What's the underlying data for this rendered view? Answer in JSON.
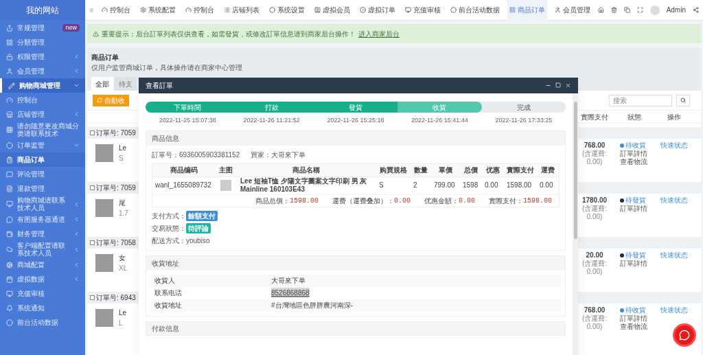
{
  "sidebar": {
    "title": "我的网站",
    "items": [
      {
        "label": "常规管理",
        "kind": "link",
        "selected": false,
        "badge": "new"
      },
      {
        "label": "分類管理",
        "kind": "link",
        "selected": false
      },
      {
        "label": "权限管理",
        "kind": "group",
        "selected": false,
        "expanded": false
      },
      {
        "label": "会员管理",
        "kind": "group",
        "selected": false,
        "expanded": false
      },
      {
        "label": "购物商城管理",
        "kind": "group",
        "selected": true,
        "expanded": true,
        "children": [
          {
            "label": "控制台",
            "kind": "link",
            "selected": false
          },
          {
            "label": "店铺管理",
            "kind": "group",
            "selected": false,
            "expanded": false
          },
          {
            "label": "请勿随意更改商城分类请联系技术",
            "kind": "link",
            "selected": false
          },
          {
            "label": "订单监管",
            "kind": "group",
            "selected": false,
            "expanded": true,
            "children": [
              {
                "label": "商品订单",
                "kind": "link",
                "selected": true
              },
              {
                "label": "评论管理",
                "kind": "link",
                "selected": false
              },
              {
                "label": "退款管理",
                "kind": "link",
                "selected": false
              }
            ]
          }
        ]
      },
      {
        "label": "购物商城请联系技术人员",
        "kind": "group",
        "selected": false,
        "expanded": false
      },
      {
        "label": "有图服务器通道",
        "kind": "group",
        "selected": false,
        "expanded": false
      },
      {
        "label": "财务管理",
        "kind": "group",
        "selected": false,
        "expanded": false
      },
      {
        "label": "客户端配置请联系技术人员",
        "kind": "group",
        "selected": false,
        "expanded": false
      },
      {
        "label": "商城配置",
        "kind": "group",
        "selected": false,
        "expanded": false
      },
      {
        "label": "虚拟数据",
        "kind": "group",
        "selected": false,
        "expanded": false
      },
      {
        "label": "充值审核",
        "kind": "link",
        "selected": false
      },
      {
        "label": "系统通知",
        "kind": "link",
        "selected": false
      },
      {
        "label": "前台活动数据",
        "kind": "link",
        "selected": false
      }
    ]
  },
  "top_tabs": [
    {
      "label": "控制台",
      "selected": false
    },
    {
      "label": "系统配置",
      "selected": false
    },
    {
      "label": "控制台",
      "selected": false
    },
    {
      "label": "店铺列表",
      "selected": false
    },
    {
      "label": "系统设置",
      "selected": false
    },
    {
      "label": "虚拟会员",
      "selected": false
    },
    {
      "label": "虚拟订单",
      "selected": false
    },
    {
      "label": "充值审核",
      "selected": false
    },
    {
      "label": "前台活动数据",
      "selected": false
    },
    {
      "label": "商品订单",
      "selected": true
    },
    {
      "label": "会员管理",
      "selected": false
    }
  ],
  "user": {
    "name": "Admin"
  },
  "alert": {
    "text": "重要提示：后台訂單列表仅供查看，如需發貨，或修改訂單信息请到商家后台操作！",
    "link": "进入商家后台"
  },
  "panel": {
    "title": "商品订单",
    "subtitle": "仅用户监管商城订单，具体操作请在商家中心管理",
    "tabs": [
      {
        "label": "全部",
        "selected": true
      },
      {
        "label": "待支",
        "selected": false
      }
    ],
    "refresh_button": "自動收",
    "search": {
      "placeholder": "搜索"
    },
    "columns": [
      "實際支付",
      "狀態",
      "操作"
    ],
    "orders": [
      {
        "checked": false,
        "order_no": "订單号: 7059",
        "name": "Le",
        "spec": "S",
        "paid": "768.00",
        "shipping": "(含運費:",
        "shipping_value": "0.00)",
        "status": "待收貨",
        "color": "#3c8dda",
        "links": [
          "訂單詳情",
          "查看物流"
        ],
        "action": "快速状态"
      },
      {
        "checked": false,
        "order_no": "订單号: 7059",
        "name": "尾",
        "spec": "1.7",
        "paid": "1780.00",
        "shipping": "(含運費:",
        "shipping_value": "0.00)",
        "status": "待發貨",
        "color": "#1f2d3d",
        "links": [
          "訂單詳情"
        ],
        "action": "快速状态"
      },
      {
        "checked": false,
        "order_no": "订單号: 7058",
        "name": "女",
        "spec": "XL",
        "paid": "20.00",
        "shipping": "(含運費:",
        "shipping_value": "0.00)",
        "status": "待發貨",
        "color": "#1f2d3d",
        "links": [
          "訂單詳情"
        ],
        "action": "快速状态"
      },
      {
        "checked": false,
        "order_no": "订單号: 6943",
        "name": "Le",
        "spec": "L",
        "paid": "768.00",
        "shipping": "(含運費:",
        "shipping_value": "0.00)",
        "status": "待收貨",
        "color": "#3c8dda",
        "links": [
          "訂單詳情",
          "查看物流"
        ],
        "action": "快速状态"
      }
    ]
  },
  "modal": {
    "title": "查看訂單",
    "steps": [
      {
        "label": "下單時間",
        "completed": true,
        "current": false,
        "time": "2022-11-25 15:07:38"
      },
      {
        "label": "打款",
        "completed": true,
        "current": false,
        "time": "2022-11-26 11:21:52"
      },
      {
        "label": "發貨",
        "completed": true,
        "current": false,
        "time": "2022-11-26 15:25:18"
      },
      {
        "label": "收貨",
        "completed": false,
        "current": true,
        "time": "2022-11-26 15:41:44"
      },
      {
        "label": "完成",
        "completed": false,
        "current": false,
        "time": "2022-11-26 17:33:25"
      }
    ],
    "goods": {
      "title": "商品信息",
      "order_label": "訂單号：",
      "order_no": "6936005903381152",
      "buyer_label": "買家：",
      "buyer": "大哥來下单",
      "columns": [
        "商品编码",
        "主图",
        "商品名稱",
        "购買規格",
        "數量",
        "單價",
        "总價",
        "优惠",
        "實際支付",
        "運费"
      ],
      "row": {
        "code": "wanl_1655089732",
        "name": "Lee 短袖T恤 夕陽文字圖案文字印刷 男 灰 Mainline 160103E43",
        "spec": "S",
        "qty": "2",
        "price": "799.00",
        "total": "1598",
        "discount": "0.00",
        "paid": "1598.00",
        "freight": "0.00"
      },
      "summary": [
        {
          "label": "商品总價：",
          "value": "1598.00"
        },
        {
          "label": "運费（運费叠加）：",
          "value": "0.00"
        },
        {
          "label": "优惠金額：",
          "value": "0.00"
        },
        {
          "label": "實際支付：",
          "value": "1598.00"
        }
      ],
      "details": [
        {
          "label": "支付方式：",
          "kind": "badge",
          "value": "餘額支付",
          "color": "#3c8dda"
        },
        {
          "label": "交易狀態：",
          "kind": "badge",
          "value": "待評論",
          "color": "#1fb5a3"
        },
        {
          "label": "配送方式：",
          "kind": "text",
          "value": "youbiso"
        }
      ]
    },
    "address": {
      "title": "收貨地址",
      "rows": [
        {
          "label": "收貨人",
          "value": "大哥來下单",
          "highlighted": false
        },
        {
          "label": "联系电话",
          "value": "8526868868",
          "highlighted": true
        },
        {
          "label": "收貨地址",
          "value": "#台灣地區色胖胖農河南深-",
          "highlighted": false
        }
      ]
    },
    "payment": {
      "title": "付款信息"
    }
  }
}
